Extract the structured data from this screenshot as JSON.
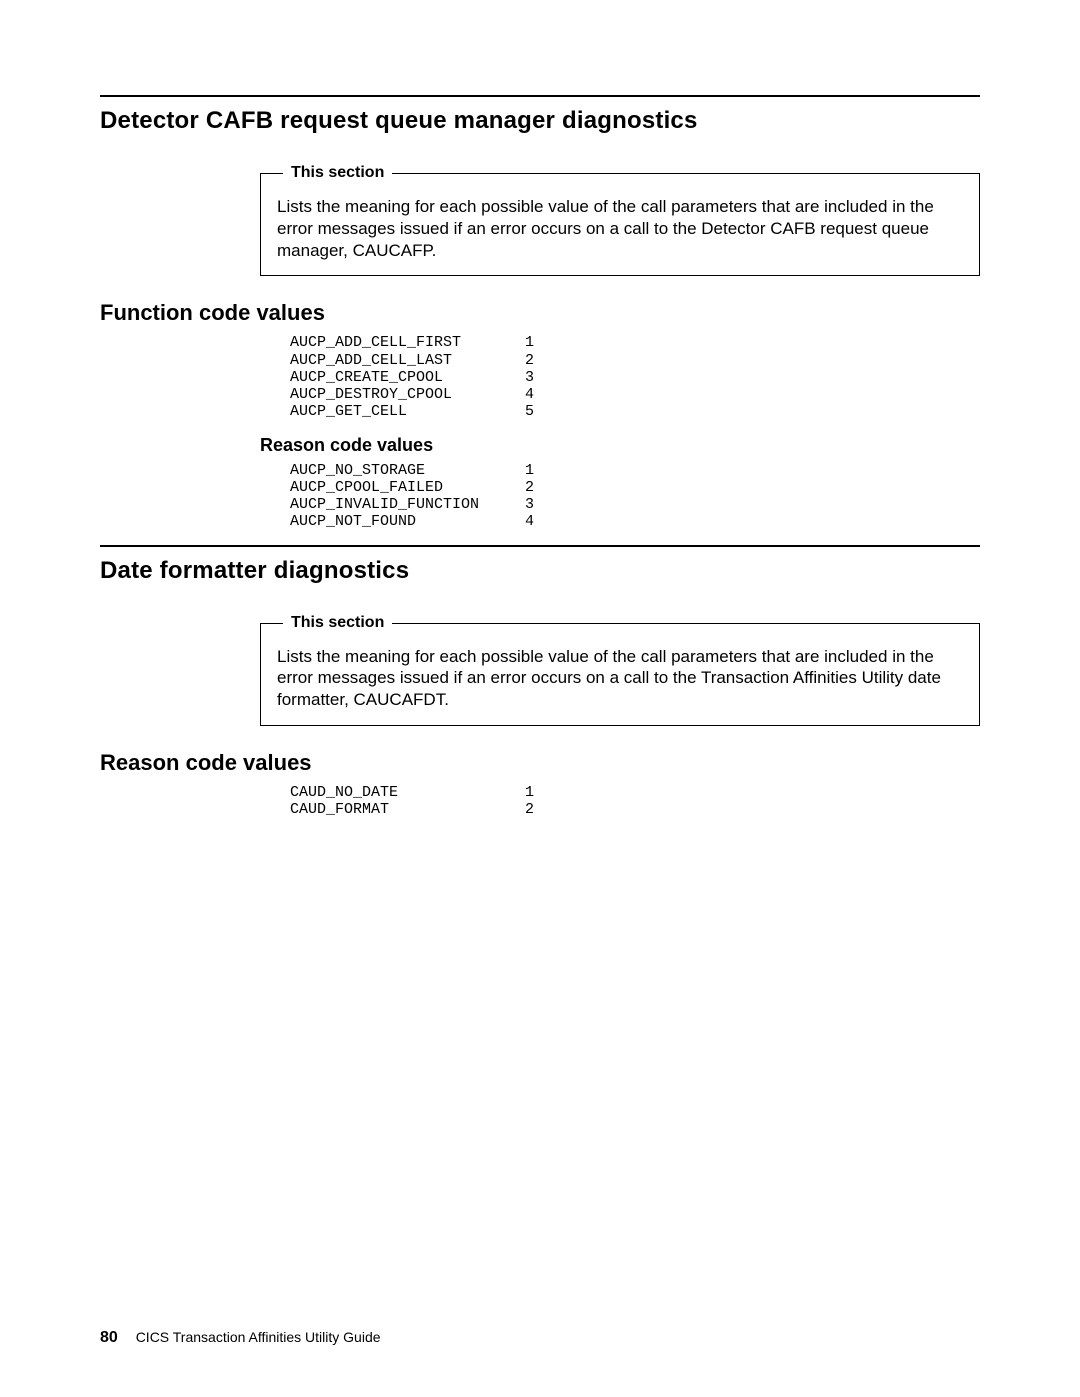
{
  "section1": {
    "title": "Detector CAFB request queue manager diagnostics",
    "box_legend": "This section",
    "box_text": "Lists the meaning for each possible value of the call parameters that are included in the error messages issued if an error occurs on a call to the Detector CAFB request queue manager, CAUCAFP.",
    "h2a": "Function code values",
    "func_codes": [
      {
        "name": "AUCP_ADD_CELL_FIRST",
        "val": "1"
      },
      {
        "name": "AUCP_ADD_CELL_LAST",
        "val": "2"
      },
      {
        "name": "AUCP_CREATE_CPOOL",
        "val": "3"
      },
      {
        "name": "AUCP_DESTROY_CPOOL",
        "val": "4"
      },
      {
        "name": "AUCP_GET_CELL",
        "val": "5"
      }
    ],
    "h3a": "Reason code values",
    "reason_codes": [
      {
        "name": "AUCP_NO_STORAGE",
        "val": "1"
      },
      {
        "name": "AUCP_CPOOL_FAILED",
        "val": "2"
      },
      {
        "name": "AUCP_INVALID_FUNCTION",
        "val": "3"
      },
      {
        "name": "AUCP_NOT_FOUND",
        "val": "4"
      }
    ]
  },
  "section2": {
    "title": "Date formatter diagnostics",
    "box_legend": "This section",
    "box_text": "Lists the meaning for each possible value of the call parameters that are included in the error messages issued if an error occurs on a call to the Transaction Affinities Utility date formatter, CAUCAFDT.",
    "h2a": "Reason code values",
    "reason_codes": [
      {
        "name": "CAUD_NO_DATE",
        "val": "1"
      },
      {
        "name": "CAUD_FORMAT",
        "val": "2"
      }
    ]
  },
  "footer": {
    "page_number": "80",
    "doc_title": "CICS Transaction Affinities Utility Guide"
  }
}
